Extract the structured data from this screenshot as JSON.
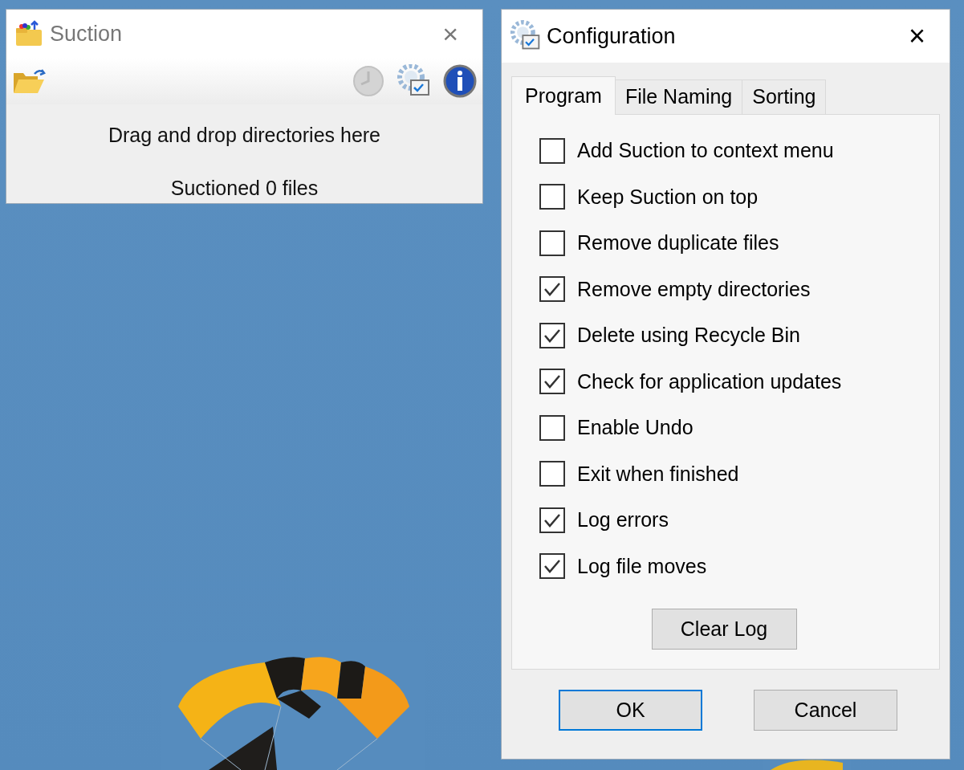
{
  "suction_window": {
    "title": "Suction",
    "close": "×",
    "drop_hint": "Drag and drop directories here",
    "status": "Suctioned 0 files"
  },
  "configuration_window": {
    "title": "Configuration",
    "close": "×",
    "tabs": [
      {
        "label": "Program",
        "selected": true
      },
      {
        "label": "File Naming",
        "selected": false
      },
      {
        "label": "Sorting",
        "selected": false
      }
    ],
    "options": [
      {
        "label": "Add Suction to context menu",
        "checked": false
      },
      {
        "label": "Keep Suction on top",
        "checked": false
      },
      {
        "label": "Remove duplicate files",
        "checked": false
      },
      {
        "label": "Remove empty directories",
        "checked": true
      },
      {
        "label": "Delete using Recycle Bin",
        "checked": true
      },
      {
        "label": "Check for application updates",
        "checked": true
      },
      {
        "label": "Enable Undo",
        "checked": false
      },
      {
        "label": "Exit when finished",
        "checked": false
      },
      {
        "label": "Log errors",
        "checked": true
      },
      {
        "label": "Log file moves",
        "checked": true
      }
    ],
    "clear_log_button": "Clear Log",
    "buttons": [
      {
        "label": "OK",
        "default": true
      },
      {
        "label": "Cancel",
        "default": false
      }
    ]
  }
}
